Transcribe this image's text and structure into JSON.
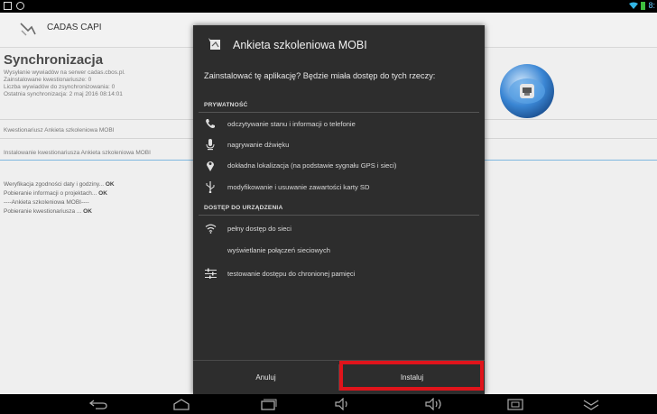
{
  "status_bar": {
    "clock": "8:"
  },
  "app": {
    "title": "CADAS CAPI"
  },
  "sync": {
    "title": "Synchronizacja",
    "lines": [
      "Wysyłanie wywiadów na serwer cadas.cbos.pl.",
      "Zainstalowane kwestionariusze: 0",
      "Liczba wywiadów do zsynchronizowania: 0",
      "Ostatnia synchronizacja: 2 maj 2016 08:14:01"
    ]
  },
  "questionnaire_label": "Kwestionariusz Ankieta szkoleniowa MOBI",
  "installing_label": "Instalowanie kwestionariusza Ankieta szkoleniowa MOBI",
  "log": {
    "line1_text": "Weryfikacja zgodności daty i godziny... ",
    "line1_status": "OK",
    "line2_text": "Pobieranie informacji o projektach... ",
    "line2_status": "OK",
    "line3_text": "----Ankieta szkoleniowa MOBI----",
    "line4_text": "Pobieranie kwestionariusza ... ",
    "line4_status": "OK"
  },
  "dialog": {
    "title": "Ankieta szkoleniowa MOBI",
    "question": "Zainstalować tę aplikację? Będzie miała dostęp do tych rzeczy:",
    "privacy_section": "PRYWATNOŚĆ",
    "privacy_items": [
      {
        "icon": "phone-icon",
        "label": "odczytywanie stanu i informacji o telefonie"
      },
      {
        "icon": "microphone-icon",
        "label": "nagrywanie dźwięku"
      },
      {
        "icon": "location-icon",
        "label": "dokładna lokalizacja (na podstawie sygnału GPS i sieci)"
      },
      {
        "icon": "usb-icon",
        "label": "modyfikowanie i usuwanie zawartości karty SD"
      }
    ],
    "device_section": "DOSTĘP DO URZĄDZENIA",
    "device_items": [
      {
        "icon": "wifi-icon",
        "label": "pełny dostęp do sieci",
        "sub": "wyświetlanie połączeń sieciowych"
      },
      {
        "icon": "settings-sliders-icon",
        "label": "testowanie dostępu do chronionej pamięci"
      }
    ],
    "cancel_label": "Anuluj",
    "install_label": "Instaluj"
  },
  "colors": {
    "highlight": "#e0141b",
    "dialog_bg": "#2d2d2d",
    "accent_line": "#7fb8e0"
  }
}
